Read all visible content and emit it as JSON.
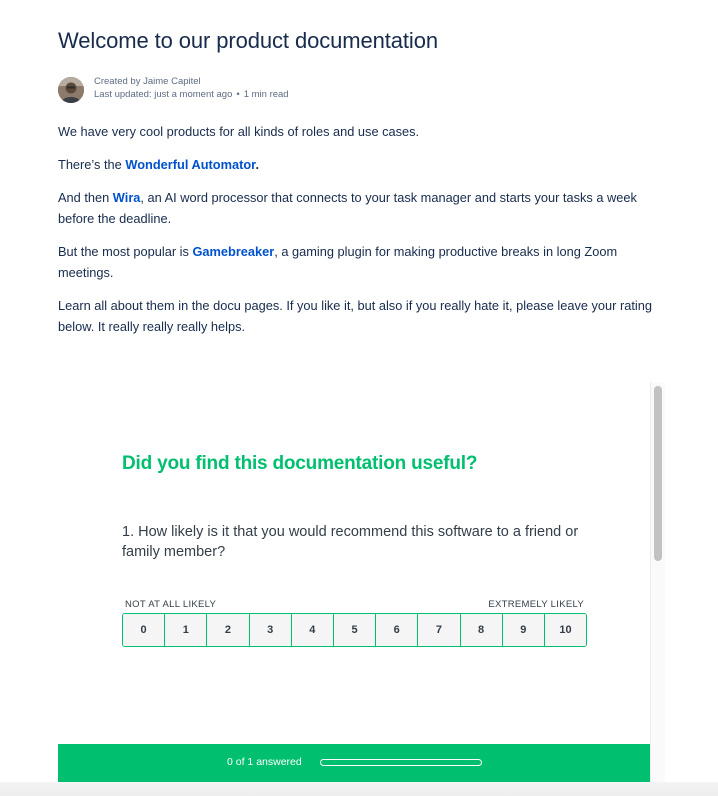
{
  "page": {
    "title": "Welcome to our product documentation",
    "byline": {
      "created_by": "Created by Jaime Capitel",
      "last_updated": "Last updated: just a moment ago",
      "separator": "•",
      "read_time": "1 min read"
    },
    "body": {
      "p1": "We have very cool products for all kinds of roles and use cases.",
      "p2_prefix": "There’s the ",
      "p2_link": "Wonderful Automator",
      "p2_suffix": ".",
      "p3_prefix": "And then ",
      "p3_link": "Wira",
      "p3_suffix": ", an AI word processor that connects to your task manager and starts your tasks a week before the deadline.",
      "p4_prefix": "But the most popular is ",
      "p4_link": "Gamebreaker",
      "p4_suffix": ", a gaming plugin for making productive breaks in long Zoom meetings.",
      "p5": "Learn all about them in the docu pages. If you like it, but also if you really hate it, please leave your rating below. It really really really helps."
    }
  },
  "survey": {
    "heading": "Did you find this documentation useful?",
    "question": "1. How likely is it that you would recommend this software to a friend or family member?",
    "scale_low_label": "NOT AT ALL LIKELY",
    "scale_high_label": "EXTREMELY LIKELY",
    "scale": [
      "0",
      "1",
      "2",
      "3",
      "4",
      "5",
      "6",
      "7",
      "8",
      "9",
      "10"
    ],
    "progress_text": "0 of 1 answered",
    "progress_fraction": 0
  },
  "colors": {
    "link": "#0052cc",
    "survey_accent": "#00bf6f",
    "title": "#172b4d",
    "meta": "#5e6c84"
  }
}
